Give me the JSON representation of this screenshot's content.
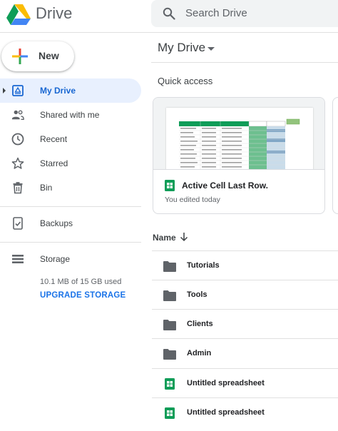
{
  "header": {
    "brand": "Drive",
    "search_placeholder": "Search Drive"
  },
  "sidebar": {
    "new_label": "New",
    "items": [
      {
        "label": "My Drive",
        "icon": "my-drive-icon",
        "active": true
      },
      {
        "label": "Shared with me",
        "icon": "people-icon"
      },
      {
        "label": "Recent",
        "icon": "clock-icon"
      },
      {
        "label": "Starred",
        "icon": "star-icon"
      },
      {
        "label": "Bin",
        "icon": "trash-icon"
      },
      {
        "label": "Backups",
        "icon": "backup-icon"
      },
      {
        "label": "Storage",
        "icon": "storage-icon"
      }
    ],
    "storage_used": "10.1 MB of 15 GB used",
    "upgrade_label": "UPGRADE STORAGE"
  },
  "main": {
    "title": "My Drive",
    "quick_access_label": "Quick access",
    "quick_access_card": {
      "title": "Active Cell Last Row.",
      "subtitle": "You edited today"
    },
    "list_header": "Name",
    "files": [
      {
        "name": "Tutorials",
        "type": "folder"
      },
      {
        "name": "Tools",
        "type": "folder"
      },
      {
        "name": "Clients",
        "type": "folder"
      },
      {
        "name": "Admin",
        "type": "folder"
      },
      {
        "name": "Untitled spreadsheet",
        "type": "spreadsheet"
      },
      {
        "name": "Untitled spreadsheet",
        "type": "spreadsheet"
      }
    ]
  },
  "colors": {
    "accent": "#1a73e8",
    "active_bg": "#e8f0fe",
    "sheets_green": "#0f9d58",
    "folder_grey": "#5f6368"
  }
}
